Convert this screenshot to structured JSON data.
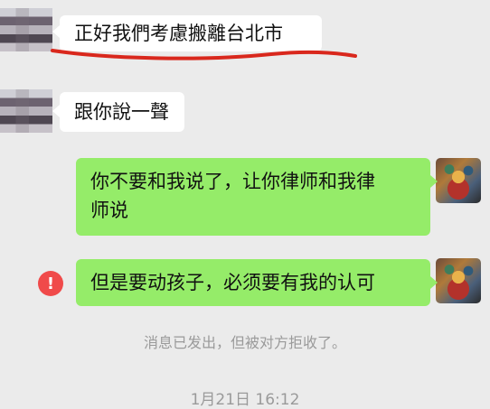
{
  "messages": [
    {
      "side": "left",
      "text": "正好我們考慮搬離台北市"
    },
    {
      "side": "left",
      "text": "跟你說一聲"
    },
    {
      "side": "right",
      "line1": "你不要和我说了，让你律师和我律",
      "line2": "师说"
    },
    {
      "side": "right",
      "text": "但是要动孩子，必须要有我的认可",
      "status_icon": "!"
    }
  ],
  "system_notice": "消息已发出，但被对方拒收了。",
  "timestamp": "1月21日 16:12",
  "colors": {
    "background": "#ebebeb",
    "left_bubble": "#ffffff",
    "right_bubble": "#95ec69",
    "error": "#f04a4a",
    "annotation_underline": "#d9281d",
    "system_text": "#9a9a9a"
  },
  "icons": {
    "status": "error-exclamation-icon",
    "left_avatar": "pixelated-avatar",
    "right_avatar": "thangka-painting-avatar"
  }
}
